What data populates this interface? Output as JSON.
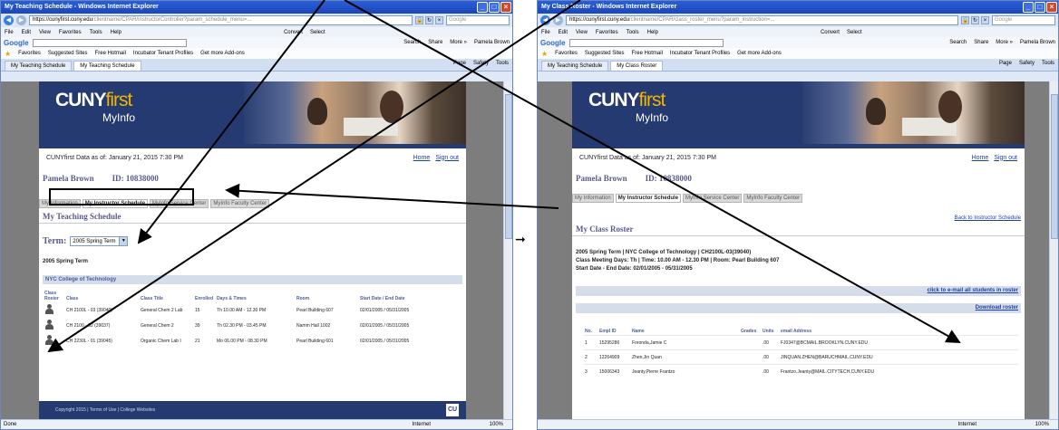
{
  "left": {
    "title": "My Teaching Schedule - Windows Internet Explorer",
    "address_domain": "https://cunyfirst.cuny.edu",
    "address_rest": "/clientname/CPAR/instructorController?param_schedule_menu=...",
    "search_placeholder": "Google",
    "menu": [
      "File",
      "Edit",
      "View",
      "Favorites",
      "Tools",
      "Help"
    ],
    "convert": [
      "Convert",
      "Select"
    ],
    "google_label": "Google",
    "google_right": [
      "Search",
      "Share",
      "More »",
      "Pamela Brown"
    ],
    "favorites": [
      "Favorites",
      "Suggested Sites",
      "Free Hotmail",
      "Incubator Tenant Profiles",
      "Get more Add-ons"
    ],
    "tabs": [
      "My Teaching Schedule",
      "My Teaching Schedule"
    ],
    "cmd": [
      "Page",
      "Safety",
      "Tools"
    ],
    "status": "Done",
    "zone": "Internet",
    "zoom": "100%",
    "logo_cuny": "CUNY",
    "logo_first": "first",
    "logo_sub": "MyInfo",
    "data_as_of": "CUNYfirst Data as of: January 21, 2015 7:30 PM",
    "home": "Home",
    "signout": "Sign out",
    "person_name": "Pamela Brown",
    "person_id": "ID: 10838000",
    "nav": [
      "My Information",
      "My Instructor Schedule",
      "MyInfo Service Center",
      "MyInfo Faculty Center"
    ],
    "section_title": "My Teaching Schedule",
    "term_label": "Term:",
    "term_value": "2005 Spring Term",
    "term_heading": "2005 Spring Term",
    "college": "NYC College of Technology",
    "table_headers": [
      "Class Roster",
      "Class",
      "Class Title",
      "Enrolled",
      "Days & Times",
      "Room",
      "Start Date / End Date"
    ],
    "rows": [
      {
        "cls": "CH 2100L - 03 (39040)",
        "title": "General Chem 2 Lab",
        "enrolled": "15",
        "days": "Th",
        "times": "10.00 AM - 12.30 PM",
        "room": "Pearl Building 607",
        "dates": "02/01/2005 / 05/31/2005"
      },
      {
        "cls": "CH 2100 - 02 (39037)",
        "title": "General Chem 2",
        "enrolled": "39",
        "days": "Th",
        "times": "02.30 PM - 03.45 PM",
        "room": "Namm Hall 1002",
        "dates": "02/01/2005 / 05/31/2005"
      },
      {
        "cls": "CH 2230L - 01 (39045)",
        "title": "Organic Chem Lab I",
        "enrolled": "21",
        "days": "Mo",
        "times": "06.00 PM - 08.30 PM",
        "room": "Pearl Building 601",
        "dates": "02/01/2005 / 05/31/2005"
      }
    ],
    "footer": "Copyright 2015 | Terms of Use | College Websites",
    "footer_badge": "CU"
  },
  "right": {
    "title": "My Class Roster - Windows Internet Explorer",
    "address_domain": "https://cunyfirst.cuny.edu",
    "address_rest": "/clientname/CPAR/class_roster_menu?param_instruction=...",
    "search_placeholder": "Google",
    "menu": [
      "File",
      "Edit",
      "View",
      "Favorites",
      "Tools",
      "Help"
    ],
    "convert": [
      "Convert",
      "Select"
    ],
    "google_label": "Google",
    "google_right": [
      "Search",
      "Share",
      "More »",
      "Pamela Brown"
    ],
    "favorites": [
      "Favorites",
      "Suggested Sites",
      "Free Hotmail",
      "Incubator Tenant Profiles",
      "Get more Add-ons"
    ],
    "tabs": [
      "My Teaching Schedule",
      "My Class Roster"
    ],
    "cmd": [
      "Page",
      "Safety",
      "Tools"
    ],
    "zone": "Internet",
    "zoom": "100%",
    "logo_cuny": "CUNY",
    "logo_first": "first",
    "logo_sub": "MyInfo",
    "data_as_of": "CUNYfirst Data as of: January 21, 2015 7:30 PM",
    "home": "Home",
    "signout": "Sign out",
    "person_name": "Pamela Brown",
    "person_id": "ID: 10838000",
    "nav": [
      "My Information",
      "My Instructor Schedule",
      "MyInfo Service Center",
      "MyInfo Faculty Center"
    ],
    "back_link": "Back to Instructor Schedule",
    "section_title": "My Class Roster",
    "info": [
      "2005 Spring Term | NYC College of Technology | CH2100L-03(39040)",
      "Class Meeting Days: Th | Time: 10.00 AM - 12.30 PM | Room: Pearl Building 607",
      "Start Date - End Date: 02/01/2005 - 05/31/2005"
    ],
    "email_all": "click to e-mail all students in roster",
    "download": "Download roster",
    "roster_headers": [
      "No.",
      "Empl ID",
      "Name",
      "Grades",
      "Units",
      "email Address"
    ],
    "roster_rows": [
      {
        "no": "1",
        "id": "15295286",
        "name": "Foronda,Jamie C",
        "units": ".00",
        "email": "FJ0347@BCMAIL.BROOKLYN.CUNY.EDU"
      },
      {
        "no": "2",
        "id": "12264909",
        "name": "Zhen,Jin Quan",
        "units": ".00",
        "email": "JINQUAN.ZHEN@BARUCHMAIL.CUNY.EDU"
      },
      {
        "no": "3",
        "id": "15006343",
        "name": "Jeanty,Pierre Frantzo",
        "units": ".00",
        "email": "Frantzo.Jeanty@MAIL.CITYTECH.CUNY.EDU"
      }
    ]
  }
}
